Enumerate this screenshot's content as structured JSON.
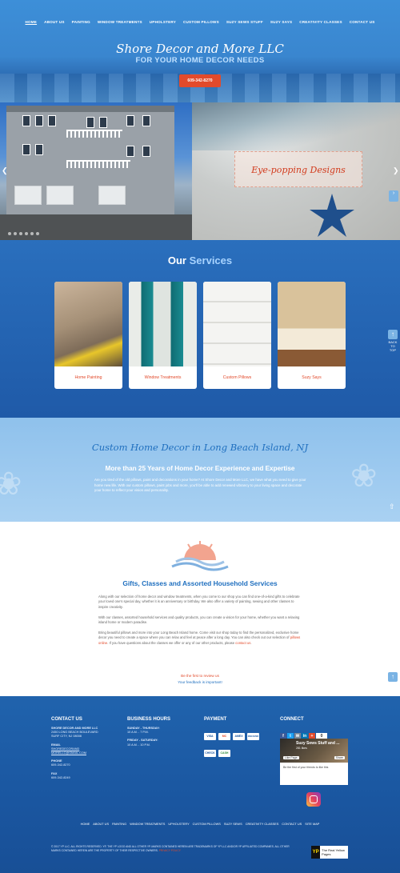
{
  "nav": {
    "items": [
      "HOME",
      "ABOUT US",
      "PAINTING",
      "WINDOW TREATMENTS",
      "UPHOLSTERY",
      "CUSTOM PILLOWS",
      "SUZY SEWS STUFF",
      "SUZY SAYS",
      "CREATIVITY CLASSES",
      "CONTACT US"
    ]
  },
  "hero": {
    "title": "Shore Decor and More LLC",
    "subtitle": "FOR YOUR HOME DECOR NEEDS",
    "phone": "609-342-8270"
  },
  "slider": {
    "caption": "Eye-popping Designs",
    "prev_icon": "chevron-left-icon",
    "next_icon": "chevron-right-icon"
  },
  "services": {
    "heading_part1": "Our",
    "heading_part2": "Services",
    "cards": [
      {
        "label": "Home Painting"
      },
      {
        "label": "Window Treatments"
      },
      {
        "label": "Custom Pillows"
      },
      {
        "label": "Suzy Says"
      }
    ],
    "back_to_top": "BACK TO TOP"
  },
  "band": {
    "script_title": "Custom Home Decor in Long Beach Island, NJ",
    "heading": "More than 25 Years of Home Decor Experience and Expertise",
    "paragraph": "Are you tired of the old pillows, paint and decorations in your home? At Shore Decor and More LLC, we have what you need to give your home new life. With our custom pillows, paint jobs and more, you'll be able to add renewed vibrancy to your living space and decorate your home to reflect your vision and personality."
  },
  "gifts": {
    "heading": "Gifts, Classes and Assorted Household Services",
    "p1": "Along with our selection of home decor and window treatments, when you come to our shop you can find one-of-a-kind gifts to celebrate your loved one's special day, whether it is an anniversary or birthday. We also offer a variety of painting, sewing and other classes to inspire creativity.",
    "p2": "With our classes, assorted household services and quality products, you can create a vision for your home, whether you want a relaxing island home or modern paradise.",
    "p3_start": "Bring beautiful pillows and more into your Long Beach Island home. Come visit our shop today to find the personalized, exclusive home decor you need to create a space where you can relax and feel at peace after a long day. You can also check out our selection of ",
    "p3_link1": "pillows online",
    "p3_mid": ". If you have questions about the classes we offer or any of our other products, please ",
    "p3_link2": "contact us",
    "p3_end": ".",
    "review_link": "Be the first to review us",
    "review_note": "Your feedback is important!"
  },
  "footer": {
    "contact": {
      "heading": "CONTACT US",
      "company": "SHORE DECOR AND MORE LLC",
      "address1": "2450 LONG BEACH BOULEVARD",
      "address2": "SURF CITY, NJ 08008",
      "email_label": "EMAIL",
      "email1": "SHOREDECORAND",
      "email2": "MORELLC@GMAIL.COM",
      "phone_label": "PHONE",
      "phone": "609-342-8270",
      "fax_label": "FAX",
      "fax": "609-342-8249"
    },
    "hours": {
      "heading": "BUSINESS HOURS",
      "days1": "SUNDAY - THURSDAY:",
      "time1": "10 A.M. - 7 P.M.",
      "days2": "FRIDAY - SATURDAY:",
      "time2": "10 A.M. - 10 P.M."
    },
    "payment": {
      "heading": "PAYMENT",
      "cards": [
        "VISA",
        "MC",
        "AMEX",
        "DISCOVER",
        "CHECK",
        "CASH"
      ]
    },
    "connect": {
      "heading": "CONNECT",
      "icons": [
        "facebook-icon",
        "twitter-icon",
        "email-icon",
        "linkedin-icon",
        "plus-icon"
      ],
      "count": "0",
      "fb_name": "Suzy Sews Stuff and ...",
      "fb_likes": "281 likes",
      "fb_like_btn": "Like Page",
      "fb_share_btn": "Share",
      "fb_sub": "Be the first of your friends to like this"
    },
    "nav": [
      "HOME",
      "ABOUT US",
      "PAINTING",
      "WINDOW TREATMENTS",
      "UPHOLSTERY",
      "CUSTOM PILLOWS",
      "SUZY SEWS",
      "CREATIVITY CLASSES",
      "CONTACT US",
      "SITE MAP"
    ],
    "copyright": "© 2017 YP LLC. ALL RIGHTS RESERVED. YP, THE YP LOGO AND ALL OTHER YP-MARKS CONTAINED HEREIN ARE TRADEMARKS OF YP LLC AND/OR YP AFFILIATED COMPANIES. ALL OTHER MARKS CONTAINED HEREIN ARE THE PROPERTY OF THEIR RESPECTIVE OWNERS.",
    "privacy": "PRIVACY POLICY",
    "yp_logo": "YP",
    "yp_text": "The Real Yellow Pages"
  },
  "colors": {
    "accent": "#e24a2b",
    "primary": "#1f6fbf",
    "light_band": "#a9d1f2"
  }
}
